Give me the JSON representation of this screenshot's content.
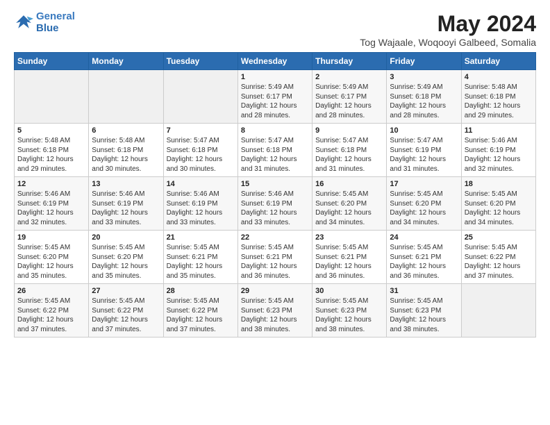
{
  "logo": {
    "line1": "General",
    "line2": "Blue"
  },
  "title": "May 2024",
  "subtitle": "Tog Wajaale, Woqooyi Galbeed, Somalia",
  "days_of_week": [
    "Sunday",
    "Monday",
    "Tuesday",
    "Wednesday",
    "Thursday",
    "Friday",
    "Saturday"
  ],
  "weeks": [
    [
      {
        "day": "",
        "content": ""
      },
      {
        "day": "",
        "content": ""
      },
      {
        "day": "",
        "content": ""
      },
      {
        "day": "1",
        "content": "Sunrise: 5:49 AM\nSunset: 6:17 PM\nDaylight: 12 hours and 28 minutes."
      },
      {
        "day": "2",
        "content": "Sunrise: 5:49 AM\nSunset: 6:17 PM\nDaylight: 12 hours and 28 minutes."
      },
      {
        "day": "3",
        "content": "Sunrise: 5:49 AM\nSunset: 6:18 PM\nDaylight: 12 hours and 28 minutes."
      },
      {
        "day": "4",
        "content": "Sunrise: 5:48 AM\nSunset: 6:18 PM\nDaylight: 12 hours and 29 minutes."
      }
    ],
    [
      {
        "day": "5",
        "content": "Sunrise: 5:48 AM\nSunset: 6:18 PM\nDaylight: 12 hours and 29 minutes."
      },
      {
        "day": "6",
        "content": "Sunrise: 5:48 AM\nSunset: 6:18 PM\nDaylight: 12 hours and 30 minutes."
      },
      {
        "day": "7",
        "content": "Sunrise: 5:47 AM\nSunset: 6:18 PM\nDaylight: 12 hours and 30 minutes."
      },
      {
        "day": "8",
        "content": "Sunrise: 5:47 AM\nSunset: 6:18 PM\nDaylight: 12 hours and 31 minutes."
      },
      {
        "day": "9",
        "content": "Sunrise: 5:47 AM\nSunset: 6:18 PM\nDaylight: 12 hours and 31 minutes."
      },
      {
        "day": "10",
        "content": "Sunrise: 5:47 AM\nSunset: 6:19 PM\nDaylight: 12 hours and 31 minutes."
      },
      {
        "day": "11",
        "content": "Sunrise: 5:46 AM\nSunset: 6:19 PM\nDaylight: 12 hours and 32 minutes."
      }
    ],
    [
      {
        "day": "12",
        "content": "Sunrise: 5:46 AM\nSunset: 6:19 PM\nDaylight: 12 hours and 32 minutes."
      },
      {
        "day": "13",
        "content": "Sunrise: 5:46 AM\nSunset: 6:19 PM\nDaylight: 12 hours and 33 minutes."
      },
      {
        "day": "14",
        "content": "Sunrise: 5:46 AM\nSunset: 6:19 PM\nDaylight: 12 hours and 33 minutes."
      },
      {
        "day": "15",
        "content": "Sunrise: 5:46 AM\nSunset: 6:19 PM\nDaylight: 12 hours and 33 minutes."
      },
      {
        "day": "16",
        "content": "Sunrise: 5:45 AM\nSunset: 6:20 PM\nDaylight: 12 hours and 34 minutes."
      },
      {
        "day": "17",
        "content": "Sunrise: 5:45 AM\nSunset: 6:20 PM\nDaylight: 12 hours and 34 minutes."
      },
      {
        "day": "18",
        "content": "Sunrise: 5:45 AM\nSunset: 6:20 PM\nDaylight: 12 hours and 34 minutes."
      }
    ],
    [
      {
        "day": "19",
        "content": "Sunrise: 5:45 AM\nSunset: 6:20 PM\nDaylight: 12 hours and 35 minutes."
      },
      {
        "day": "20",
        "content": "Sunrise: 5:45 AM\nSunset: 6:20 PM\nDaylight: 12 hours and 35 minutes."
      },
      {
        "day": "21",
        "content": "Sunrise: 5:45 AM\nSunset: 6:21 PM\nDaylight: 12 hours and 35 minutes."
      },
      {
        "day": "22",
        "content": "Sunrise: 5:45 AM\nSunset: 6:21 PM\nDaylight: 12 hours and 36 minutes."
      },
      {
        "day": "23",
        "content": "Sunrise: 5:45 AM\nSunset: 6:21 PM\nDaylight: 12 hours and 36 minutes."
      },
      {
        "day": "24",
        "content": "Sunrise: 5:45 AM\nSunset: 6:21 PM\nDaylight: 12 hours and 36 minutes."
      },
      {
        "day": "25",
        "content": "Sunrise: 5:45 AM\nSunset: 6:22 PM\nDaylight: 12 hours and 37 minutes."
      }
    ],
    [
      {
        "day": "26",
        "content": "Sunrise: 5:45 AM\nSunset: 6:22 PM\nDaylight: 12 hours and 37 minutes."
      },
      {
        "day": "27",
        "content": "Sunrise: 5:45 AM\nSunset: 6:22 PM\nDaylight: 12 hours and 37 minutes."
      },
      {
        "day": "28",
        "content": "Sunrise: 5:45 AM\nSunset: 6:22 PM\nDaylight: 12 hours and 37 minutes."
      },
      {
        "day": "29",
        "content": "Sunrise: 5:45 AM\nSunset: 6:23 PM\nDaylight: 12 hours and 38 minutes."
      },
      {
        "day": "30",
        "content": "Sunrise: 5:45 AM\nSunset: 6:23 PM\nDaylight: 12 hours and 38 minutes."
      },
      {
        "day": "31",
        "content": "Sunrise: 5:45 AM\nSunset: 6:23 PM\nDaylight: 12 hours and 38 minutes."
      },
      {
        "day": "",
        "content": ""
      }
    ]
  ]
}
